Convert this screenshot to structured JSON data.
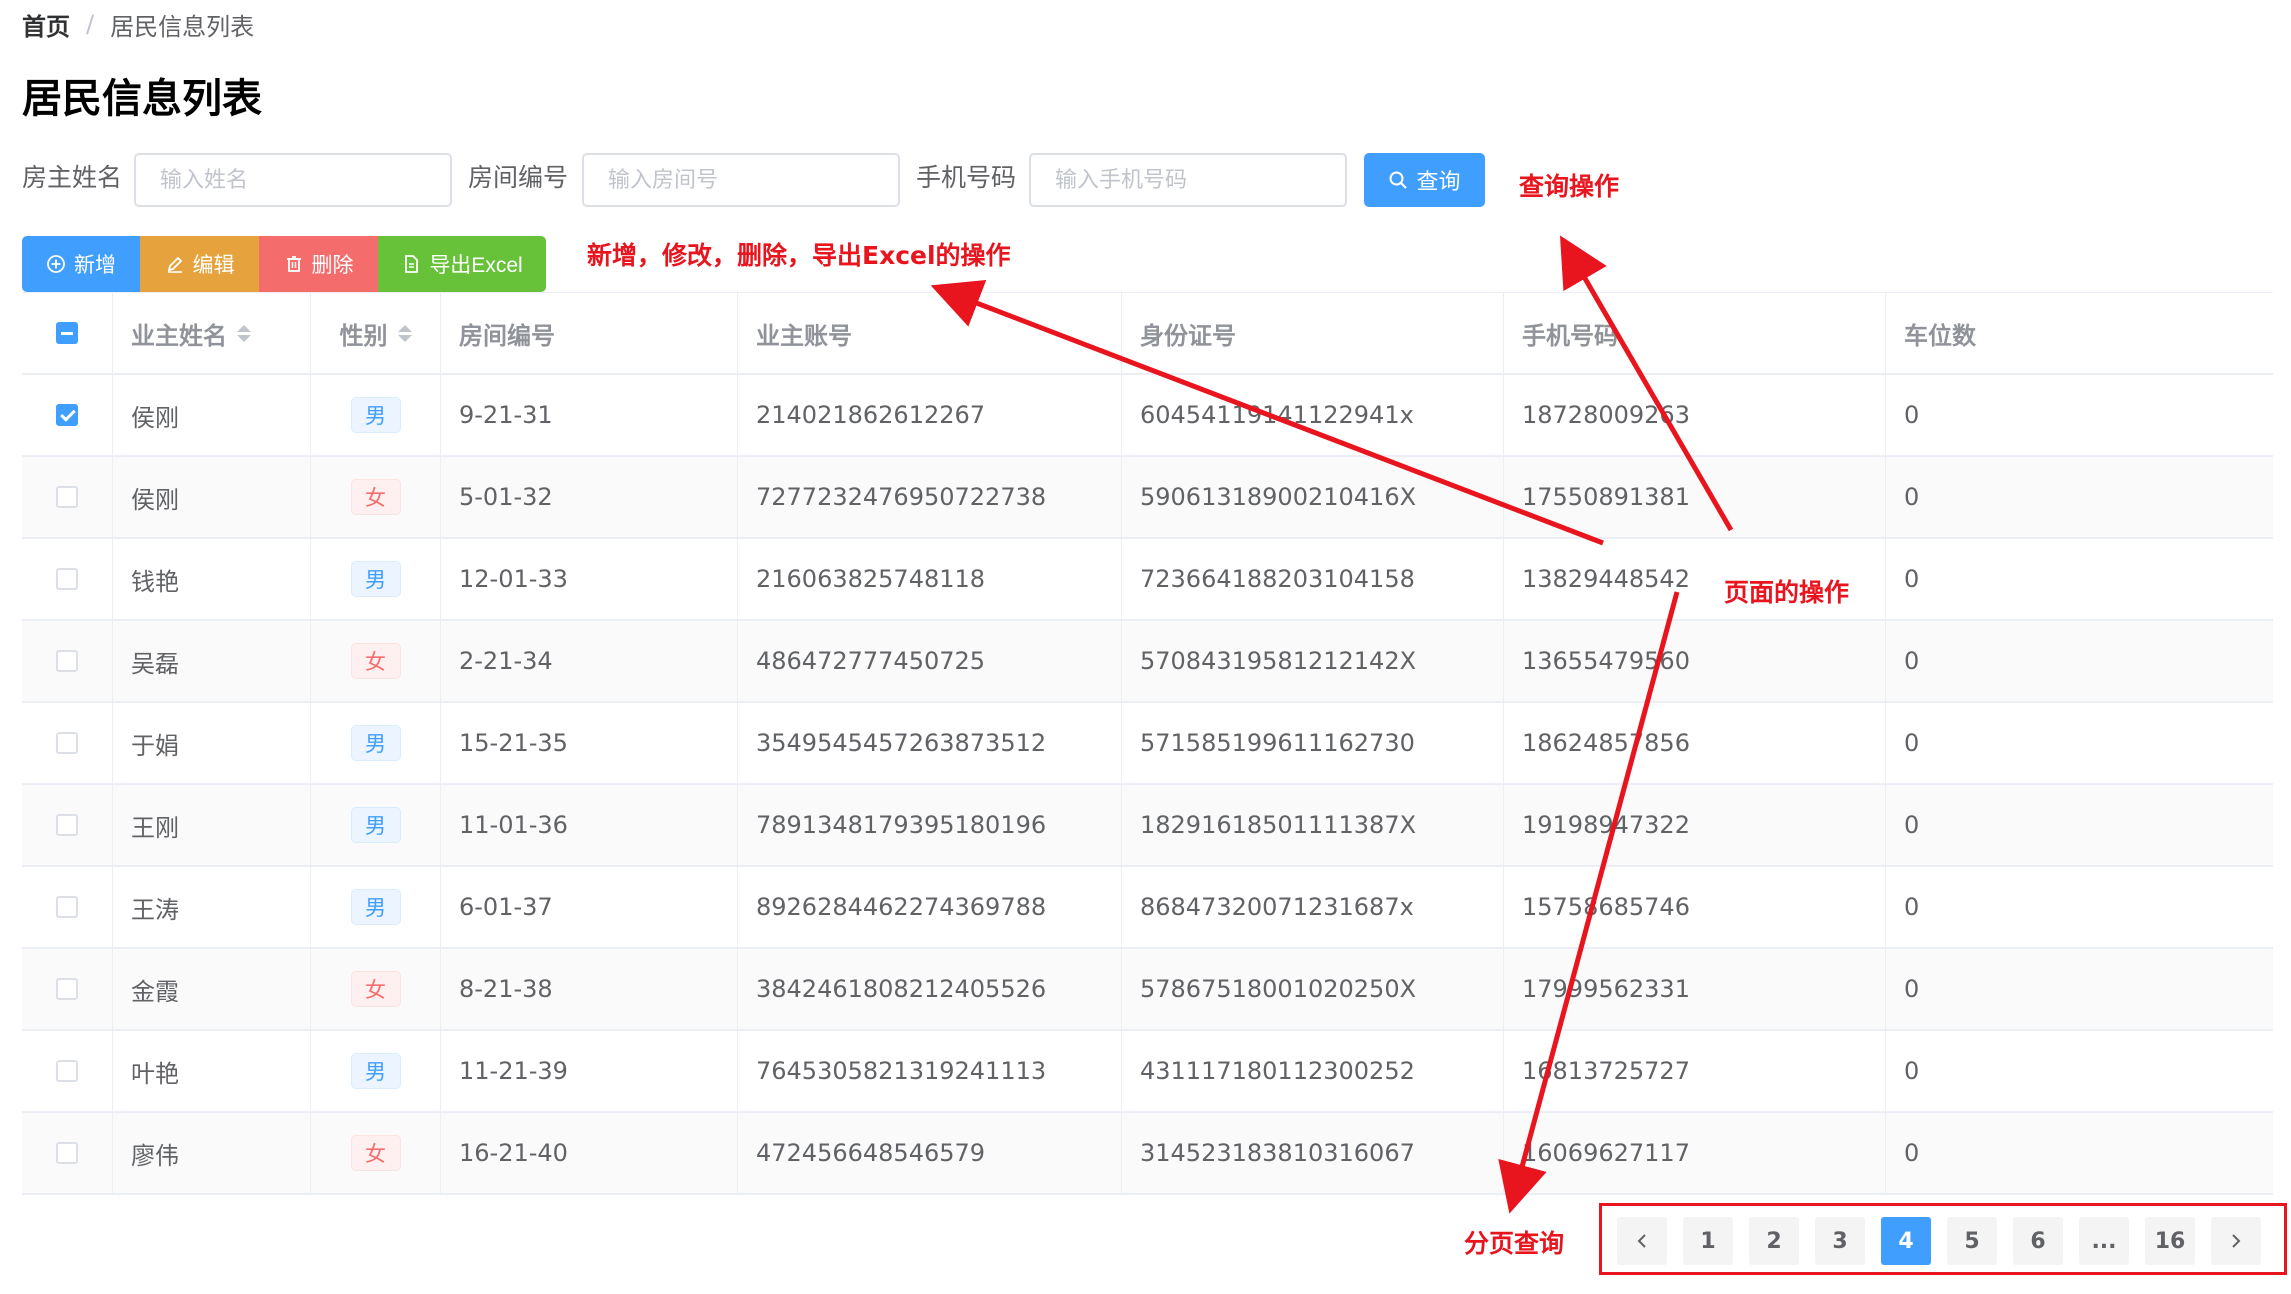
{
  "breadcrumb": {
    "home": "首页",
    "separator": "/",
    "current": "居民信息列表"
  },
  "page_title": "居民信息列表",
  "search": {
    "owner_name_label": "房主姓名",
    "owner_name_placeholder": "输入姓名",
    "room_label": "房间编号",
    "room_placeholder": "输入房间号",
    "phone_label": "手机号码",
    "phone_placeholder": "输入手机号码",
    "query_button": "查询"
  },
  "toolbar": {
    "add": "新增",
    "edit": "编辑",
    "delete": "删除",
    "export": "导出Excel"
  },
  "annotations": {
    "query_ops": "查询操作",
    "crud_ops": "新增，修改，删除，导出Excel的操作",
    "page_ops": "页面的操作",
    "pagination": "分页查询"
  },
  "table": {
    "columns": [
      "业主姓名",
      "性别",
      "房间编号",
      "业主账号",
      "身份证号",
      "手机号码",
      "车位数"
    ],
    "rows": [
      {
        "checked": true,
        "name": "侯刚",
        "gender": "男",
        "room": "9-21-31",
        "account": "214021862612267",
        "id_card": "60454119141122941x",
        "phone": "18728009263",
        "parking": "0"
      },
      {
        "checked": false,
        "name": "侯刚",
        "gender": "女",
        "room": "5-01-32",
        "account": "7277232476950722738",
        "id_card": "59061318900210416X",
        "phone": "17550891381",
        "parking": "0"
      },
      {
        "checked": false,
        "name": "钱艳",
        "gender": "男",
        "room": "12-01-33",
        "account": "216063825748118",
        "id_card": "723664188203104158",
        "phone": "13829448542",
        "parking": "0"
      },
      {
        "checked": false,
        "name": "吴磊",
        "gender": "女",
        "room": "2-21-34",
        "account": "486472777450725",
        "id_card": "57084319581212142X",
        "phone": "13655479560",
        "parking": "0"
      },
      {
        "checked": false,
        "name": "于娟",
        "gender": "男",
        "room": "15-21-35",
        "account": "3549545457263873512",
        "id_card": "571585199611162730",
        "phone": "18624857856",
        "parking": "0"
      },
      {
        "checked": false,
        "name": "王刚",
        "gender": "男",
        "room": "11-01-36",
        "account": "7891348179395180196",
        "id_card": "18291618501111387X",
        "phone": "19198947322",
        "parking": "0"
      },
      {
        "checked": false,
        "name": "王涛",
        "gender": "男",
        "room": "6-01-37",
        "account": "8926284462274369788",
        "id_card": "86847320071231687x",
        "phone": "15758685746",
        "parking": "0"
      },
      {
        "checked": false,
        "name": "金霞",
        "gender": "女",
        "room": "8-21-38",
        "account": "3842461808212405526",
        "id_card": "57867518001020250X",
        "phone": "17999562331",
        "parking": "0"
      },
      {
        "checked": false,
        "name": "叶艳",
        "gender": "男",
        "room": "11-21-39",
        "account": "7645305821319241113",
        "id_card": "431117180112300252",
        "phone": "16813725727",
        "parking": "0"
      },
      {
        "checked": false,
        "name": "廖伟",
        "gender": "女",
        "room": "16-21-40",
        "account": "472456648546579",
        "id_card": "314523183810316067",
        "phone": "16069627117",
        "parking": "0"
      }
    ]
  },
  "pagination": {
    "pages": [
      "1",
      "2",
      "3",
      "4",
      "5",
      "6",
      "...",
      "16"
    ],
    "current": "4"
  },
  "colors": {
    "primary": "#409eff",
    "warning": "#e6a23c",
    "danger": "#f56c6c",
    "success": "#67c23a",
    "annotation": "#e8141e"
  },
  "icons": {
    "add": "plus-circle-icon",
    "edit": "pencil-icon",
    "delete": "trash-icon",
    "export": "document-icon",
    "query": "search-icon",
    "prev": "chevron-left-icon",
    "next": "chevron-right-icon"
  }
}
